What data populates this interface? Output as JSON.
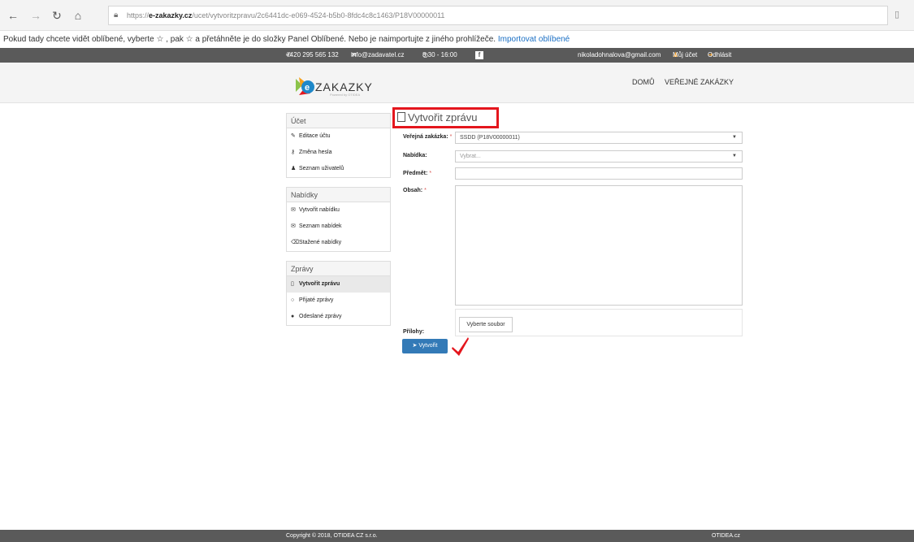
{
  "browser": {
    "url_host": "e-zakazky.cz",
    "url_prefix": "https://",
    "url_path": "/ucet/vytvoritzpravu/2c6441dc-e069-4524-b5b0-8fdc4c8c1463/P18V00000011"
  },
  "favorites_bar": {
    "text": "Pokud tady chcete vidět oblíbené, vyberte ☆ , pak ☆ a přetáhněte je do složky Panel Oblíbené. Nebo je naimportujte z jiného prohlížeče. ",
    "import_link": "Importovat oblíbené"
  },
  "topbar": {
    "phone": "+420 295 565 132",
    "email": "info@zadavatel.cz",
    "hours": "8:30 - 16:00",
    "user_email": "nikoladohnalova@gmail.com",
    "account": "Můj účet",
    "logout": "Odhlásit"
  },
  "header": {
    "logo_text": "ZAKAZKY",
    "logo_sub": "Powered by OTIDEA",
    "nav_home": "DOMŮ",
    "nav_public": "VEŘEJNÉ ZAKÁZKY"
  },
  "sidebar": {
    "account": {
      "title": "Účet",
      "items": [
        {
          "icon": "edit-icon",
          "glyph": "✎",
          "label": "Editace účtu"
        },
        {
          "icon": "key-icon",
          "glyph": "⚷",
          "label": "Změna hesla"
        },
        {
          "icon": "users-icon",
          "glyph": "👥",
          "label": "Seznam uživatelů"
        }
      ]
    },
    "offers": {
      "title": "Nabídky",
      "items": [
        {
          "icon": "envelope-icon",
          "glyph": "✉",
          "label": "Vytvořit nabídku"
        },
        {
          "icon": "envelope-filled-icon",
          "glyph": "✉",
          "label": "Seznam nabídek"
        },
        {
          "icon": "trash-icon",
          "glyph": "🗑",
          "label": "Stažené nabídky"
        }
      ]
    },
    "messages": {
      "title": "Zprávy",
      "items": [
        {
          "icon": "document-icon",
          "glyph": "🗋",
          "label": "Vytvořit zprávu",
          "active": true
        },
        {
          "icon": "comment-icon",
          "glyph": "○",
          "label": "Přijaté zprávy"
        },
        {
          "icon": "comment-filled-icon",
          "glyph": "●",
          "label": "Odeslané zprávy"
        }
      ]
    }
  },
  "form": {
    "title": "Vytvořit zprávu",
    "contract_label": "Veřejná zakázka:",
    "contract_value": "SSDD (P18V00000011)",
    "offer_label": "Nabídka:",
    "offer_placeholder": "Vybrat...",
    "subject_label": "Předmět:",
    "body_label": "Obsah:",
    "attachments_label": "Přílohy:",
    "file_button": "Vyberte soubor",
    "submit": "Vytvořit"
  },
  "footer": {
    "copyright": "Copyright © 2018, OTIDEA CZ s.r.o.",
    "brand": "OTIDEA.cz"
  },
  "colors": {
    "accent": "#337ab7",
    "highlight": "#e4161d",
    "dark_bar": "#5a5a5a"
  }
}
